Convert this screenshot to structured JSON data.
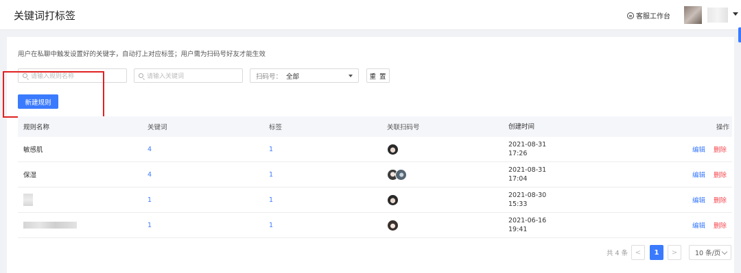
{
  "header": {
    "title": "关键词打标签",
    "cs_workbench": "客服工作台"
  },
  "description": "用户在私聊中触发设置好的关键字，自动打上对应标签；用户需为扫码号好友才能生效",
  "filters": {
    "rule_name_placeholder": "请输入规则名称",
    "keyword_placeholder": "请输入关键词",
    "qr_label": "扫码号：",
    "qr_value": "全部",
    "reset_label": "重 置"
  },
  "new_rule_button": "新建规则",
  "table": {
    "columns": [
      "规则名称",
      "关键词",
      "标签",
      "关联扫码号",
      "创建时间",
      "操作"
    ],
    "rows": [
      {
        "name": "敏感肌",
        "keywords": "4",
        "tags": "1",
        "date": "2021-08-31",
        "time": "17:26",
        "edit": "编辑",
        "delete": "删除"
      },
      {
        "name": "保湿",
        "keywords": "4",
        "tags": "1",
        "date": "2021-08-31",
        "time": "17:04",
        "edit": "编辑",
        "delete": "删除"
      },
      {
        "name": "",
        "keywords": "1",
        "tags": "1",
        "date": "2021-08-30",
        "time": "15:33",
        "edit": "编辑",
        "delete": "删除"
      },
      {
        "name": "",
        "keywords": "1",
        "tags": "1",
        "date": "2021-06-16",
        "time": "19:41",
        "edit": "编辑",
        "delete": "删除"
      }
    ]
  },
  "pagination": {
    "total": "共 4 条",
    "prev": "<",
    "current_page": "1",
    "next": ">",
    "page_size": "10 条/页"
  },
  "colors": {
    "accent": "#3a7afe",
    "danger": "#f5454d",
    "highlight_box": "#e02020"
  }
}
